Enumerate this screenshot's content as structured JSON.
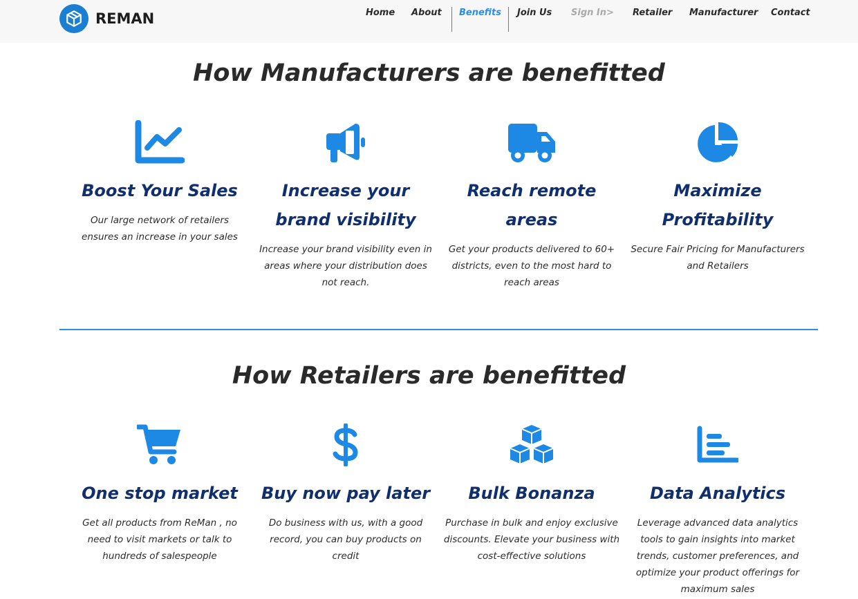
{
  "brand": {
    "name": "REMAN",
    "logo_icon": "cube-icon"
  },
  "nav": {
    "home": "Home",
    "about": "About",
    "benefits": "Benefits",
    "join_us": "Join Us",
    "sign_in": "Sign In>",
    "retailer": "Retailer",
    "manufacturer": "Manufacturer",
    "contact": "Contact",
    "active": "Benefits"
  },
  "colors": {
    "accent": "#2b8ee6",
    "icon": "#1e88e5",
    "card_title": "#0f2f6e",
    "heading": "#2a2a2a",
    "nav_bg": "#f7f7f7",
    "disabled": "#a9a9a9"
  },
  "manufacturers": {
    "title": "How Manufacturers are benefitted",
    "cards": [
      {
        "icon": "line-chart-icon",
        "title": "Boost Your Sales",
        "desc": "Our large network of retailers ensures an increase in your sales"
      },
      {
        "icon": "megaphone-icon",
        "title": "Increase your brand visibility",
        "desc": "Increase your brand visibility even in areas where your distribution does not reach."
      },
      {
        "icon": "truck-icon",
        "title": "Reach remote areas",
        "desc": "Get your products delivered to 60+ districts, even to the most hard to reach areas"
      },
      {
        "icon": "pie-chart-icon",
        "title": "Maximize Profitability",
        "desc": "Secure Fair Pricing for Manufacturers and Retailers"
      }
    ]
  },
  "retailers": {
    "title": "How Retailers are benefitted",
    "cards": [
      {
        "icon": "shopping-cart-icon",
        "title": "One stop market",
        "desc": "Get all products from ReMan , no need to visit markets or talk to hundreds of salespeople"
      },
      {
        "icon": "dollar-sign-icon",
        "title": "Buy now pay later",
        "desc": "Do business with us, with a good record, you can buy products on credit"
      },
      {
        "icon": "cubes-icon",
        "title": "Bulk Bonanza",
        "desc": "Purchase in bulk and enjoy exclusive discounts. Elevate your business with cost-effective solutions"
      },
      {
        "icon": "bar-chart-icon",
        "title": "Data Analytics",
        "desc": "Leverage advanced data analytics tools to gain insights into market trends, customer preferences, and optimize your product offerings for maximum sales"
      }
    ]
  }
}
